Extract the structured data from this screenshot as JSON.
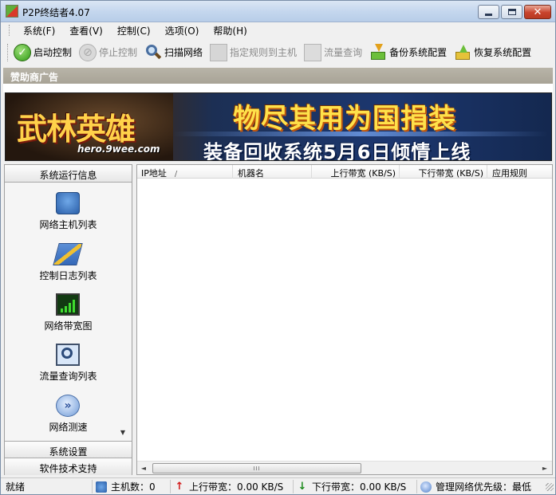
{
  "window": {
    "title": "P2P终结者4.07",
    "close_label": "✕"
  },
  "menu": {
    "items": [
      "系统(F)",
      "查看(V)",
      "控制(C)",
      "选项(O)",
      "帮助(H)"
    ]
  },
  "toolbar": {
    "start": "启动控制",
    "stop": "停止控制",
    "scan": "扫描网络",
    "assign_rule": "指定规则到主机",
    "flow_query": "流量查询",
    "backup": "备份系统配置",
    "restore": "恢复系统配置"
  },
  "sponsor": {
    "label": "赞助商广告",
    "brand": "武林英雄",
    "url": "hero.9wee.com",
    "slogan1": "物尽其用为国捐装",
    "slogan2": "装备回收系统5月6日倾情上线"
  },
  "left_panel": {
    "header": "系统运行信息",
    "items": [
      {
        "label": "网络主机列表",
        "icon": "computer-host-icon"
      },
      {
        "label": "控制日志列表",
        "icon": "log-pen-icon"
      },
      {
        "label": "网络带宽图",
        "icon": "bandwidth-chart-icon"
      },
      {
        "label": "流量查询列表",
        "icon": "magnifier-icon"
      },
      {
        "label": "网络测速",
        "icon": "speed-test-icon"
      }
    ],
    "footer1": "系统设置",
    "footer2": "软件技术支持"
  },
  "list": {
    "columns": [
      "IP地址",
      "机器名",
      "上行带宽 (KB/S)",
      "下行带宽 (KB/S)",
      "应用规则"
    ],
    "sort_indicator": "/",
    "rows": [],
    "scroll_thumb": "III"
  },
  "status": {
    "ready": "就绪",
    "hosts": "主机数：0",
    "upload": "上行带宽：0.00 KB/S",
    "download": "下行带宽：0.00 KB/S",
    "priority": "管理网络优先级：最低"
  }
}
